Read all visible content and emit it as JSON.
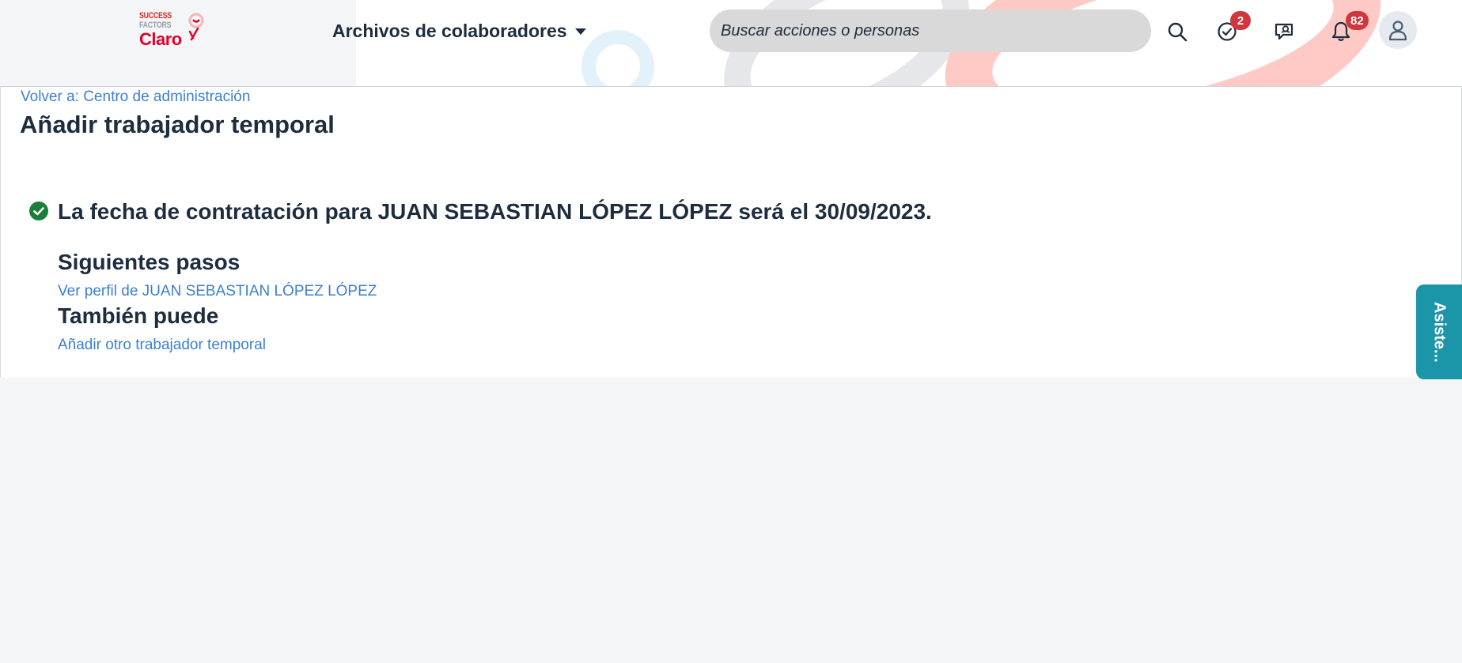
{
  "header": {
    "logo": {
      "line1": "SUCCESS",
      "line2": "FACTORS",
      "line3": "Claro"
    },
    "nav_title": "Archivos de colaboradores",
    "search": {
      "placeholder": "Buscar acciones o personas"
    },
    "icons": {
      "search": "search-icon",
      "approvals": "check-circle-icon",
      "approvals_badge": "2",
      "chat": "chat-icon",
      "notifications": "bell-icon",
      "notifications_badge": "82",
      "profile": "user-icon"
    }
  },
  "main": {
    "back_link": "Volver a: Centro de administración",
    "title": "Añadir trabajador temporal",
    "success_message": "La fecha de contratación para JUAN SEBASTIAN LÓPEZ LÓPEZ será el 30/09/2023.",
    "next_steps_heading": "Siguientes pasos",
    "view_profile_link": "Ver perfil de JUAN SEBASTIAN LÓPEZ LÓPEZ",
    "also_heading": "También puede",
    "add_another_link": "Añadir otro trabajador temporal"
  },
  "assistant_tab": {
    "label": "Asiste..."
  },
  "colors": {
    "accent_link": "#3b7fd1",
    "success": "#1a7f3c",
    "badge": "#d0363d",
    "assistant": "#1a96a8"
  }
}
